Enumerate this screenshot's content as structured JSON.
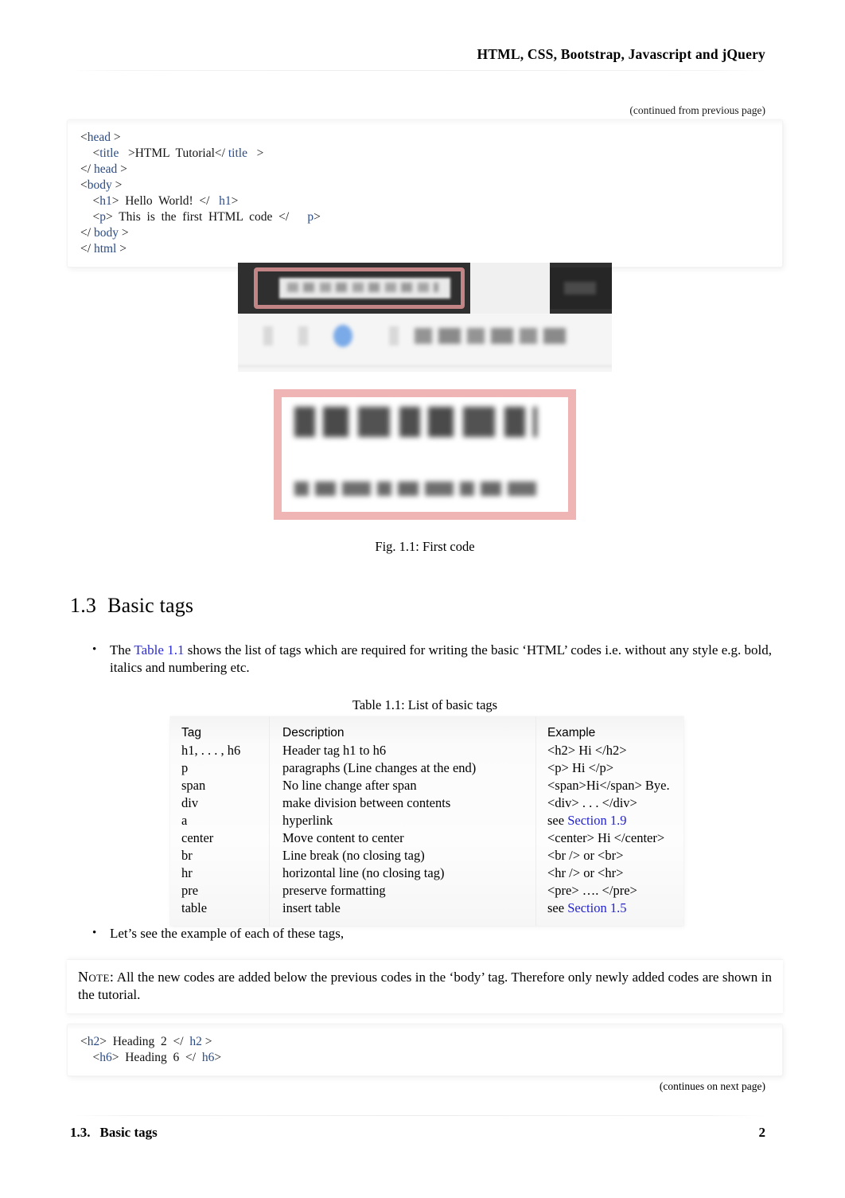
{
  "header": {
    "title": "HTML, CSS, Bootstrap, Javascript and jQuery"
  },
  "continued_note": "(continued from previous page)",
  "code_block_top": {
    "lines": [
      [
        {
          "t": "txt",
          "s": "<"
        },
        {
          "t": "tag",
          "s": "head"
        },
        {
          "t": "txt",
          "s": " >"
        }
      ],
      [
        {
          "t": "txt",
          "s": "    <"
        },
        {
          "t": "tag",
          "s": "title"
        },
        {
          "t": "txt",
          "s": "   >HTML  Tutorial</ "
        },
        {
          "t": "tag",
          "s": "title"
        },
        {
          "t": "txt",
          "s": "   >"
        }
      ],
      [
        {
          "t": "txt",
          "s": "</ "
        },
        {
          "t": "tag",
          "s": "head"
        },
        {
          "t": "txt",
          "s": " >"
        }
      ],
      [
        {
          "t": "txt",
          "s": "<"
        },
        {
          "t": "tag",
          "s": "body"
        },
        {
          "t": "txt",
          "s": " >"
        }
      ],
      [
        {
          "t": "txt",
          "s": "    <"
        },
        {
          "t": "tag",
          "s": "h1"
        },
        {
          "t": "txt",
          "s": ">  Hello  World!  </   "
        },
        {
          "t": "tag",
          "s": "h1"
        },
        {
          "t": "txt",
          "s": ">"
        }
      ],
      [
        {
          "t": "txt",
          "s": "    <"
        },
        {
          "t": "tag",
          "s": "p"
        },
        {
          "t": "txt",
          "s": ">  This  is  the  first  HTML  code  </      "
        },
        {
          "t": "tag",
          "s": "p"
        },
        {
          "t": "txt",
          "s": ">"
        }
      ],
      [
        {
          "t": "txt",
          "s": "</ "
        },
        {
          "t": "tag",
          "s": "body"
        },
        {
          "t": "txt",
          "s": " >"
        }
      ],
      [
        {
          "t": "txt",
          "s": "</ "
        },
        {
          "t": "tag",
          "s": "html"
        },
        {
          "t": "txt",
          "s": " >"
        }
      ]
    ]
  },
  "figure": {
    "caption": "Fig. 1.1: First code",
    "screenshot_1_alt": "browser window with address bar highlighted in red",
    "screenshot_2_alt": "rendered page showing Hello World! heading and paragraph, outlined in red",
    "rendered_heading": "Hello World!",
    "rendered_paragraph": "This is the first HTML code",
    "highlight_color": "#e79a9a"
  },
  "section": {
    "number": "1.3",
    "title": "Basic tags"
  },
  "bullets": {
    "first": {
      "before_link": "The ",
      "link": "Table 1.1",
      "after_link": "  shows the list of tags which are required for writing the basic ‘HTML’ codes i.e. without any style e.g. bold, italics and numbering etc."
    },
    "second": {
      "text": "Let’s see the example of each of these tags,"
    }
  },
  "table": {
    "caption": "Table 1.1: List of basic tags",
    "headers": [
      "Tag",
      "Description",
      "Example"
    ],
    "rows": [
      {
        "tag": "h1, . . . , h6",
        "description": "Header tag h1 to h6",
        "example": "<h2> Hi </h2>",
        "example_prefix": "",
        "example_link": ""
      },
      {
        "tag": "p",
        "description": "paragraphs (Line changes at the end)",
        "example": "<p> Hi </p>",
        "example_prefix": "",
        "example_link": ""
      },
      {
        "tag": "span",
        "description": "No line change after span",
        "example": "<span>Hi</span> Bye.",
        "example_prefix": "",
        "example_link": ""
      },
      {
        "tag": "div",
        "description": "make division between contents",
        "example": "<div> . . . </div>",
        "example_prefix": "",
        "example_link": ""
      },
      {
        "tag": "a",
        "description": "hyperlink",
        "example": "",
        "example_prefix": "see ",
        "example_link": "Section 1.9"
      },
      {
        "tag": "center",
        "description": "Move content to center",
        "example": "<center> Hi </center>",
        "example_prefix": "",
        "example_link": ""
      },
      {
        "tag": "br",
        "description": "Line break (no closing tag)",
        "example": "<br /> or <br>",
        "example_prefix": "",
        "example_link": ""
      },
      {
        "tag": "hr",
        "description": "horizontal line (no closing tag)",
        "example": "<hr /> or <hr>",
        "example_prefix": "",
        "example_link": ""
      },
      {
        "tag": "pre",
        "description": "preserve formatting",
        "example": "<pre>  ….  </pre>",
        "example_prefix": "",
        "example_link": ""
      },
      {
        "tag": "table",
        "description": "insert table",
        "example": "",
        "example_prefix": "see ",
        "example_link": "Section 1.5"
      }
    ]
  },
  "note": {
    "label": "Note:",
    "text": "  All the new codes are added below the previous codes in the ‘body’ tag.     Therefore only newly added codes are shown in the tutorial."
  },
  "code_block_bottom": {
    "lines": [
      [
        {
          "t": "txt",
          "s": "<"
        },
        {
          "t": "tag",
          "s": "h2"
        },
        {
          "t": "txt",
          "s": ">  Heading  2  </  "
        },
        {
          "t": "tag",
          "s": "h2"
        },
        {
          "t": "txt",
          "s": " >"
        }
      ],
      [
        {
          "t": "txt",
          "s": "    <"
        },
        {
          "t": "tag",
          "s": "h6"
        },
        {
          "t": "txt",
          "s": ">  Heading  6  </  "
        },
        {
          "t": "tag",
          "s": "h6"
        },
        {
          "t": "txt",
          "s": ">"
        }
      ]
    ]
  },
  "continues_note": "(continues on next page)",
  "footer": {
    "section_number": "1.3.",
    "section_title": "Basic tags",
    "page_number": "2"
  },
  "colors": {
    "tag_blue": "#2a4b86",
    "link_blue": "#2222cc",
    "text": "#000000"
  }
}
